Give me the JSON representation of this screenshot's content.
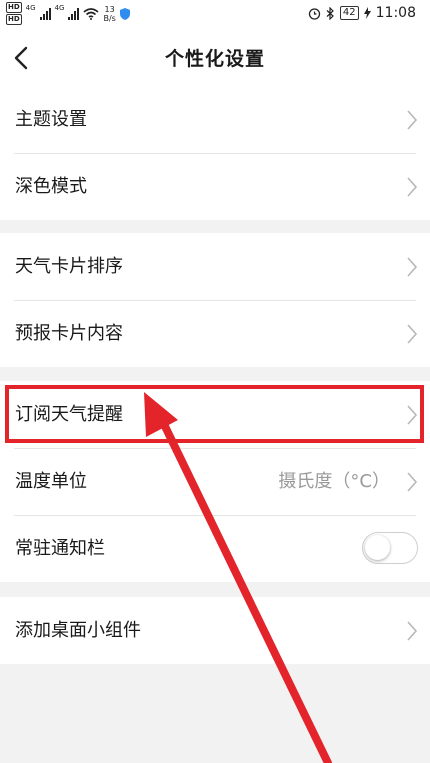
{
  "status_bar": {
    "hd1": "HD",
    "hd2": "HD",
    "network": "4G",
    "network2": "4G",
    "speed_value": "13",
    "speed_unit": "B/s",
    "battery": "42",
    "time": "11:08"
  },
  "header": {
    "title": "个性化设置"
  },
  "groups": [
    {
      "items": [
        {
          "label": "主题设置"
        },
        {
          "label": "深色模式"
        }
      ]
    },
    {
      "items": [
        {
          "label": "天气卡片排序"
        },
        {
          "label": "预报卡片内容"
        }
      ]
    },
    {
      "items": [
        {
          "label": "订阅天气提醒",
          "highlighted": true
        },
        {
          "label": "温度单位",
          "value": "摄氏度（°C）"
        },
        {
          "label": "常驻通知栏",
          "toggle": false
        }
      ]
    },
    {
      "items": [
        {
          "label": "添加桌面小组件"
        }
      ]
    }
  ],
  "colors": {
    "background": "#f2f2f2",
    "card": "#ffffff",
    "annotation_red": "#e3242b",
    "secondary_text": "#9a9a9a"
  }
}
